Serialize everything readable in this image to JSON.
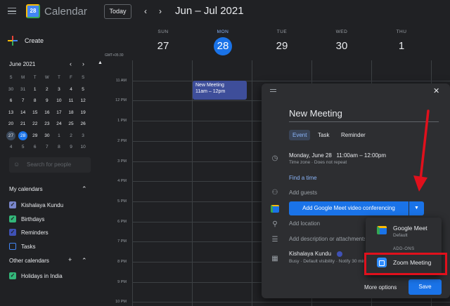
{
  "header": {
    "app_title": "Calendar",
    "logo_text": "28",
    "today_label": "Today",
    "prev_icon": "‹",
    "next_icon": "›",
    "date_range": "Jun – Jul 2021"
  },
  "sidebar": {
    "create_label": "Create",
    "mini_calendar": {
      "title": "June 2021",
      "weekday_headers": [
        "S",
        "M",
        "T",
        "W",
        "T",
        "F",
        "S"
      ],
      "weeks": [
        [
          "30",
          "31",
          "1",
          "2",
          "3",
          "4",
          "5"
        ],
        [
          "6",
          "7",
          "8",
          "9",
          "10",
          "11",
          "12"
        ],
        [
          "13",
          "14",
          "15",
          "16",
          "17",
          "18",
          "19"
        ],
        [
          "20",
          "21",
          "22",
          "23",
          "24",
          "25",
          "26"
        ],
        [
          "27",
          "28",
          "29",
          "30",
          "1",
          "2",
          "3"
        ],
        [
          "4",
          "5",
          "6",
          "7",
          "8",
          "9",
          "10"
        ]
      ]
    },
    "search_placeholder": "Search for people",
    "my_calendars_title": "My calendars",
    "my_calendars": [
      {
        "label": "Kishalaya Kundu",
        "color": "#7986cb",
        "checked": true
      },
      {
        "label": "Birthdays",
        "color": "#33b679",
        "checked": true
      },
      {
        "label": "Reminders",
        "color": "#3f51b5",
        "checked": true
      },
      {
        "label": "Tasks",
        "color": "#4285f4",
        "checked": false
      }
    ],
    "other_calendars_title": "Other calendars",
    "other_calendars": [
      {
        "label": "Holidays in India",
        "color": "#33b679",
        "checked": true
      }
    ]
  },
  "grid": {
    "timezone_label": "GMT+05:30",
    "days": [
      {
        "dow": "SUN",
        "num": "27"
      },
      {
        "dow": "MON",
        "num": "28",
        "current": true
      },
      {
        "dow": "TUE",
        "num": "29"
      },
      {
        "dow": "WED",
        "num": "30"
      },
      {
        "dow": "THU",
        "num": "1"
      }
    ],
    "hours": [
      "11 AM",
      "12 PM",
      "1 PM",
      "2 PM",
      "3 PM",
      "4 PM",
      "5 PM",
      "6 PM",
      "7 PM",
      "8 PM",
      "9 PM",
      "10 PM"
    ],
    "event": {
      "title": "New Meeting",
      "time": "11am – 12pm"
    }
  },
  "dialog": {
    "title": "New Meeting",
    "tabs": [
      "Event",
      "Task",
      "Reminder"
    ],
    "active_tab": "Event",
    "date": "Monday, June 28",
    "time_range": "11:00am  –  12:00pm",
    "timezone_note": "Time zone  ·  Does not repeat",
    "find_time": "Find a time",
    "add_guests": "Add guests",
    "meet_button": "Add Google Meet video conferencing",
    "add_location": "Add location",
    "add_description": "Add description or attachments",
    "owner": "Kishalaya Kundu",
    "owner_sub": "Busy · Default visibility · Notify 30 minutes before",
    "more_options": "More options",
    "save": "Save"
  },
  "conference_menu": {
    "google_meet_label": "Google Meet",
    "google_meet_sub": "Default",
    "addons_heading": "ADD-ONS",
    "zoom_label": "Zoom Meeting"
  },
  "colors": {
    "accent": "#1a73e8",
    "highlight": "#e0101c",
    "background": "#202124"
  }
}
